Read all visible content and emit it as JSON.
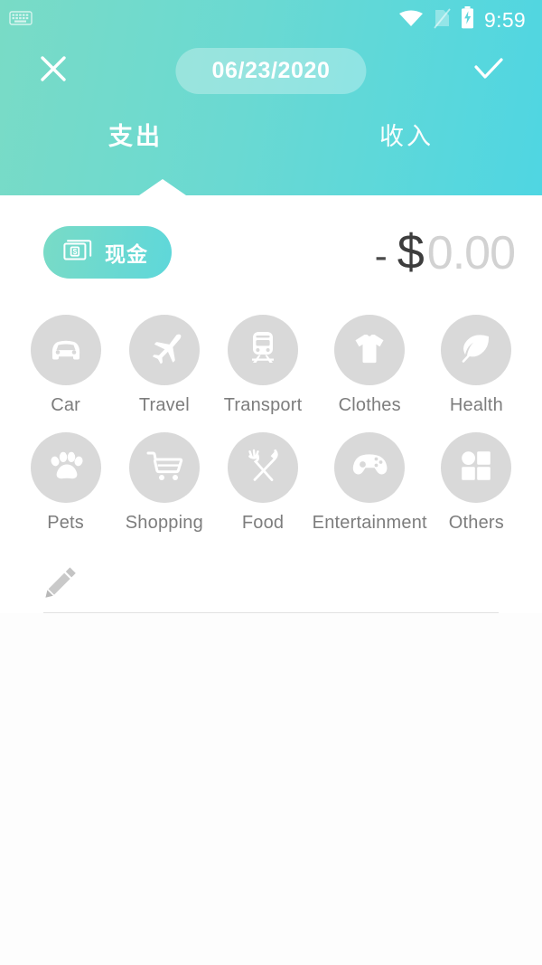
{
  "status_bar": {
    "time": "9:59",
    "icons": [
      "keyboard-icon",
      "wifi-icon",
      "no-sim-icon",
      "battery-charging-icon"
    ]
  },
  "header": {
    "close_label": "✕",
    "confirm_label": "✓",
    "date": "06/23/2020",
    "tabs": [
      {
        "label": "支出",
        "active": true
      },
      {
        "label": "收入",
        "active": false
      }
    ]
  },
  "entry": {
    "account_label": "现金",
    "account_icon": "banknote-dollar-icon",
    "amount_sign": "-",
    "amount_currency": "$",
    "amount_value": "0.00"
  },
  "categories": [
    {
      "label": "Car",
      "icon": "car-icon"
    },
    {
      "label": "Travel",
      "icon": "airplane-icon"
    },
    {
      "label": "Transport",
      "icon": "train-icon"
    },
    {
      "label": "Clothes",
      "icon": "tshirt-icon"
    },
    {
      "label": "Health",
      "icon": "leaf-icon"
    },
    {
      "label": "Pets",
      "icon": "paw-icon"
    },
    {
      "label": "Shopping",
      "icon": "shopping-cart-icon"
    },
    {
      "label": "Food",
      "icon": "fork-knife-icon"
    },
    {
      "label": "Entertainment",
      "icon": "gamepad-icon"
    },
    {
      "label": "Others",
      "icon": "grid-squares-icon"
    }
  ],
  "note": {
    "icon": "pencil-icon",
    "value": "",
    "placeholder": ""
  },
  "colors": {
    "header_gradient_start": "#79dbc6",
    "header_gradient_end": "#4fd6e2",
    "chip_gradient_start": "#79dbc6",
    "chip_gradient_end": "#5ed7da",
    "category_circle": "#d9d9d9",
    "category_label": "#7d7d7d",
    "amount_placeholder": "#d2d2d2"
  }
}
